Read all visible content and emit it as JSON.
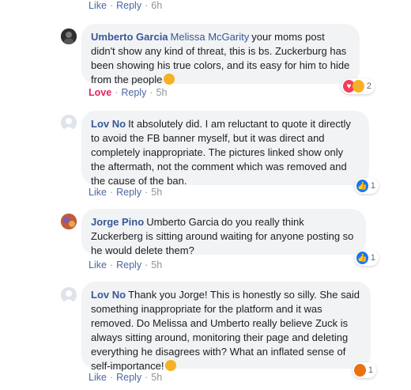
{
  "top_actions": {
    "like": "Like",
    "reply": "Reply",
    "time": "6h"
  },
  "comments": [
    {
      "author": "Umberto Garcia",
      "mention": "Melissa McGarity",
      "text": "your moms post didn't show any kind of threat, this is bs. Zuckerburg has been showing his true colors, and its easy for him to hide from the people",
      "reaction_label": "Love",
      "reply": "Reply",
      "time": "5h",
      "reaction_count": "2",
      "reaction_icons": [
        "love-icon",
        "haha-icon"
      ]
    },
    {
      "author": "Lov No",
      "text": "It absolutely did. I am reluctant to quote it directly to avoid the FB banner myself, but it was direct and completely inappropriate. The pictures linked show only the aftermath, not the comment which was removed and the cause of the ban.",
      "like": "Like",
      "reply": "Reply",
      "time": "5h",
      "reaction_count": "1",
      "reaction_icons": [
        "like-icon"
      ]
    },
    {
      "author": "Jorge Pino",
      "mention": "Umberto Garcia",
      "text": "do you really think Zuckerberg is sitting around waiting for anyone posting so he would delete them?",
      "like": "Like",
      "reply": "Reply",
      "time": "5h",
      "reaction_count": "1",
      "reaction_icons": [
        "like-icon"
      ]
    },
    {
      "author": "Lov No",
      "text": "Thank you Jorge! This is honestly so silly. She said something inappropriate for the platform and it was removed. Do Melissa and Umberto really believe Zuck is always sitting around, monitoring their page and deleting everything he disagrees with? What an inflated sense of self-importance!",
      "like": "Like",
      "reply": "Reply",
      "time": "5h",
      "reaction_count": "1",
      "reaction_icons": [
        "angry-icon"
      ]
    }
  ],
  "colors": {
    "link": "#385898",
    "action": "#4b67a1",
    "muted": "#8d949e",
    "love": "#e0245e",
    "bubble": "#f2f3f5",
    "like_blue": "#1877f2",
    "angry_orange": "#e9710f"
  }
}
